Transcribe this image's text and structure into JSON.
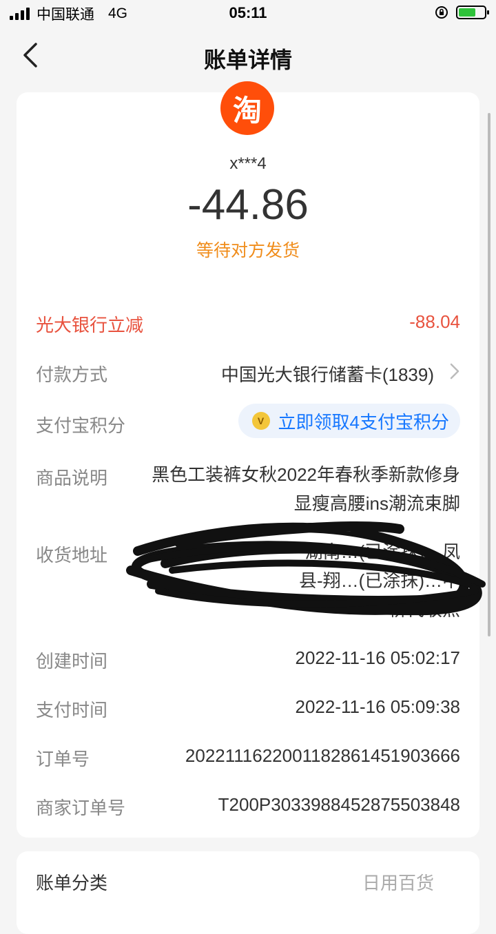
{
  "status_bar": {
    "carrier": "中国联通",
    "network": "4G",
    "time": "05:11",
    "battery_color": "#2ec23a"
  },
  "nav": {
    "back_icon": "chevron-left-icon",
    "title": "账单详情"
  },
  "merchant": {
    "logo_glyph": "淘",
    "logo_color": "#ff4e0a",
    "name": "x***4"
  },
  "amount": "-44.86",
  "status": "等待对方发货",
  "status_color": "#f08c1a",
  "details": {
    "discount": {
      "label": "光大银行立减",
      "value": "-88.04",
      "color": "#e8523e"
    },
    "payment_method": {
      "label": "付款方式",
      "value": "中国光大银行储蓄卡(1839)"
    },
    "points": {
      "label": "支付宝积分",
      "value": "立即领取4支付宝积分"
    },
    "product": {
      "label": "商品说明",
      "value": "黑色工装裤女秋2022年春秋季新款修身显瘦高腰ins潮流束脚"
    },
    "address": {
      "label": "收货地址",
      "value_line1": "湖南…(已涂抹)…凤",
      "value_line2": "县-翔…(已涂抹)…中",
      "value_line3": "桥代收点"
    },
    "created": {
      "label": "创建时间",
      "value": "2022-11-16 05:02:17"
    },
    "paid": {
      "label": "支付时间",
      "value": "2022-11-16 05:09:38"
    },
    "order_no": {
      "label": "订单号",
      "value": "2022111622001182861451903666"
    },
    "merchant_order_no": {
      "label": "商家订单号",
      "value": "T200P3033988452875503848"
    }
  },
  "bottom_card": {
    "label": "账单分类",
    "value": "日用百货"
  }
}
